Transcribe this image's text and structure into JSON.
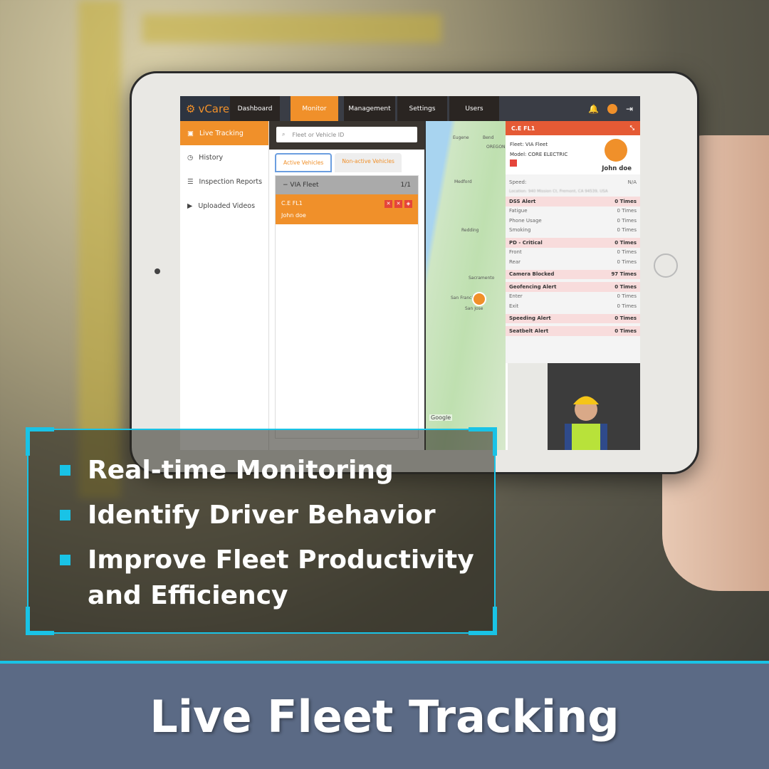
{
  "app": {
    "logo": "vCare",
    "nav": [
      "Dashboard",
      "Monitor",
      "Management",
      "Settings",
      "Users"
    ],
    "active_nav": "Monitor"
  },
  "sidebar": {
    "items": [
      {
        "label": "Live Tracking",
        "icon": "map-icon"
      },
      {
        "label": "History",
        "icon": "clock-icon"
      },
      {
        "label": "Inspection Reports",
        "icon": "list-icon"
      },
      {
        "label": "Uploaded Videos",
        "icon": "video-icon"
      }
    ]
  },
  "vehicles": {
    "search_placeholder": "Fleet or Vehicle ID",
    "tabs": [
      "Active Vehicles",
      "Non-active Vehicles"
    ],
    "fleet_name": "VIA Fleet",
    "fleet_count": "1/1",
    "vehicle_id": "C.E FL1",
    "driver": "John doe"
  },
  "map": {
    "labels": [
      "Eugene",
      "Bend",
      "OREGON",
      "Medford",
      "Redding",
      "Sacramento",
      "San Francisco",
      "San Jose",
      "Google"
    ]
  },
  "panel": {
    "title": "C.E FL1",
    "fleet": "Fleet: VIA Fleet",
    "model": "Model: CORE ELECTRIC",
    "driver": "John doe",
    "speed_label": "Speed:",
    "speed": "N/A",
    "location": "Location: 940 Mission Ct, Fremont, CA 94539, USA",
    "alerts": [
      {
        "label": "DSS Alert",
        "value": "0 Times",
        "header": true
      },
      {
        "label": "Fatigue",
        "value": "0 Times"
      },
      {
        "label": "Phone Usage",
        "value": "0 Times"
      },
      {
        "label": "Smoking",
        "value": "0 Times"
      },
      {
        "label": "PD - Critical",
        "value": "0 Times",
        "header": true
      },
      {
        "label": "Front",
        "value": "0 Times"
      },
      {
        "label": "Rear",
        "value": "0 Times"
      },
      {
        "label": "Camera Blocked",
        "value": "97 Times",
        "header": true
      },
      {
        "label": "Geofencing Alert",
        "value": "0 Times",
        "header": true
      },
      {
        "label": "Enter",
        "value": "0 Times"
      },
      {
        "label": "Exit",
        "value": "0 Times"
      },
      {
        "label": "Speeding Alert",
        "value": "0 Times",
        "header": true
      },
      {
        "label": "Seatbelt Alert",
        "value": "0 Times",
        "header": true
      }
    ]
  },
  "features": [
    "Real-time Monitoring",
    "Identify Driver Behavior",
    "Improve Fleet Productivity",
    "and Efficiency"
  ],
  "banner": "Live Fleet Tracking",
  "colors": {
    "accent": "#f0902a",
    "alert": "#e55a35",
    "cyan": "#19c3e6",
    "banner": "#5b6a85"
  }
}
